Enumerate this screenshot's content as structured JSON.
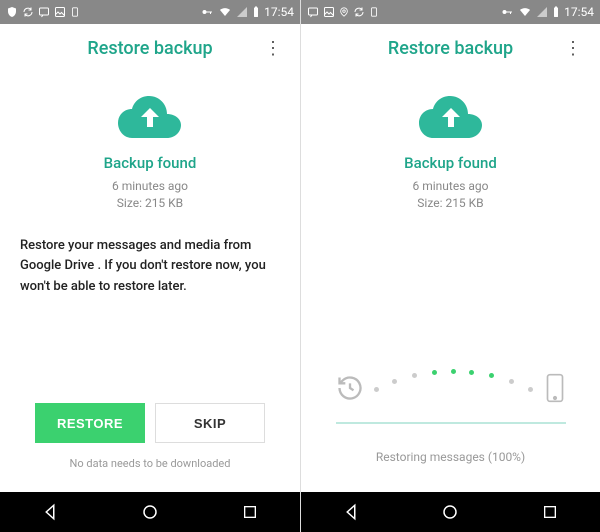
{
  "status": {
    "time": "17:54"
  },
  "app": {
    "title": "Restore backup"
  },
  "backup": {
    "found_label": "Backup found",
    "time_ago": "6 minutes ago",
    "size_label": "Size: 215 KB"
  },
  "left": {
    "description": "Restore your messages and media from Google Drive . If you don't restore now, you won't be able to restore later.",
    "restore_btn": "RESTORE",
    "skip_btn": "SKIP",
    "footer": "No data needs to be downloaded"
  },
  "right": {
    "progress_label": "Restoring messages (100%)"
  },
  "colors": {
    "accent": "#1fa58a",
    "green_btn": "#3bd16f"
  }
}
